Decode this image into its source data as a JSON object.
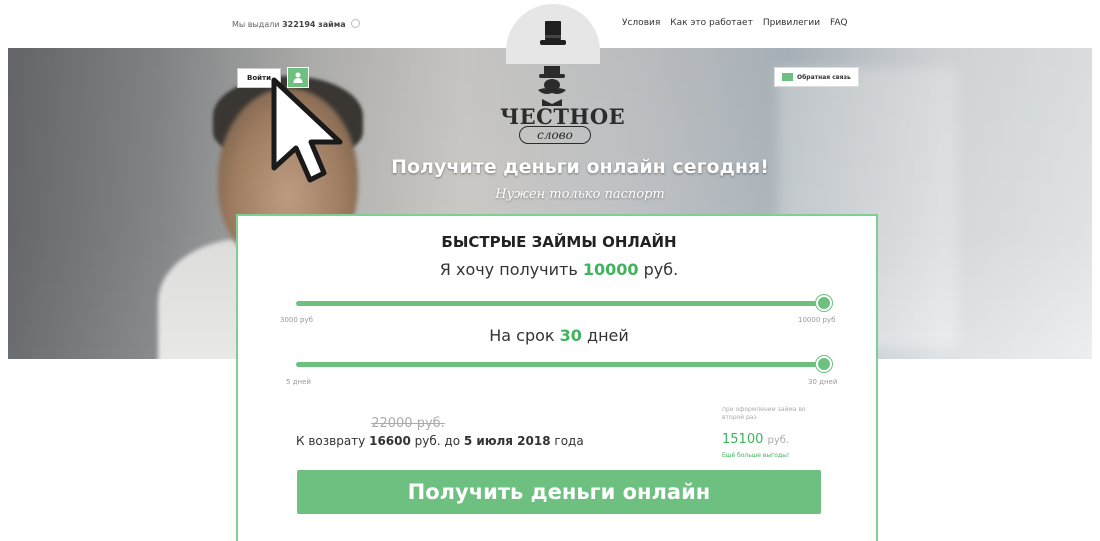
{
  "header": {
    "loans_prefix": "Мы выдали",
    "loans_count": "322194",
    "loans_suffix": "займа",
    "nav": [
      "Условия",
      "Как это работает",
      "Привилегии",
      "FAQ"
    ]
  },
  "hero": {
    "login_label": "Войти",
    "feedback_label": "Обратная связь",
    "logo_title": "ЧЕСТНОЕ",
    "logo_sub": "слово",
    "headline": "Получите деньги онлайн сегодня!",
    "subheadline": "Нужен только паспорт"
  },
  "calculator": {
    "title": "БЫСТРЫЕ ЗАЙМЫ ОНЛАЙН",
    "amount_prefix": "Я хочу получить",
    "amount_value": "10000",
    "amount_unit": "руб.",
    "amount_min_label": "3000 руб",
    "amount_max_label": "10000 руб",
    "amount_fraction": 1.0,
    "term_prefix": "На срок",
    "term_value": "30",
    "term_unit": "дней",
    "term_min_label": "5 дней",
    "term_max_label": "30 дней",
    "term_fraction": 1.0,
    "old_price": "22000 руб.",
    "return_prefix": "К возврату",
    "return_amount": "16600",
    "return_mid": "руб. до",
    "return_date": "5 июля 2018",
    "return_suffix": "года",
    "promo_note": "при оформлении займа во второй раз",
    "promo_price": "15100",
    "promo_unit": "руб.",
    "promo_more": "Ещё больше выгоды!",
    "cta_label": "Получить деньги онлайн"
  },
  "colors": {
    "accent": "#6dc080",
    "accent_text": "#3fb45c"
  }
}
